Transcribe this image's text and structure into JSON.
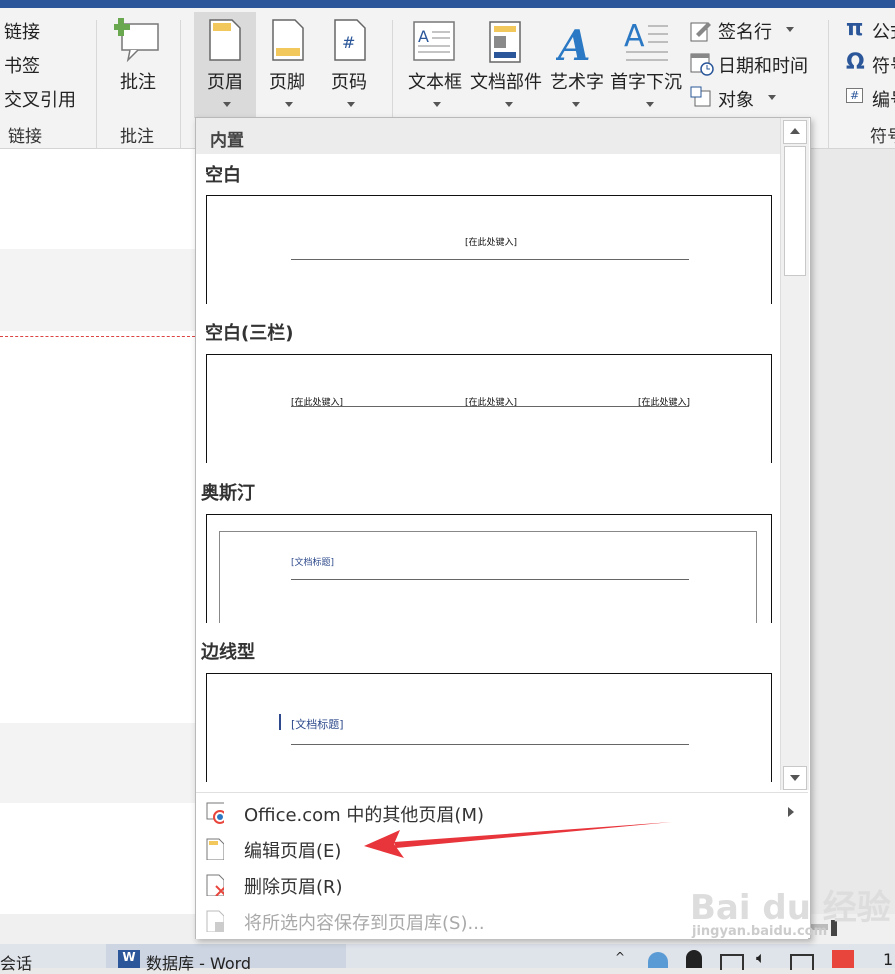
{
  "ribbon": {
    "links_group": {
      "items": [
        "链接",
        "书签",
        "交叉引用"
      ],
      "label": "链接"
    },
    "comments_group": {
      "button": "批注",
      "label": "批注"
    },
    "header_footer_group": {
      "header": "页眉",
      "footer": "页脚",
      "page_number": "页码"
    },
    "text_group": {
      "textbox": "文本框",
      "quickparts": "文档部件",
      "wordart": "艺术字",
      "dropcap": "首字下沉",
      "signature": "签名行",
      "datetime": "日期和时间",
      "object": "对象"
    },
    "symbols_group": {
      "equation": "公式",
      "symbol": "符号",
      "number": "编号",
      "label": "符号"
    }
  },
  "gallery": {
    "header": "内置",
    "sections": [
      {
        "title": "空白",
        "placeholders": [
          "[在此处键入]"
        ]
      },
      {
        "title": "空白(三栏)",
        "placeholders": [
          "[在此处键入]",
          "[在此处键入]",
          "[在此处键入]"
        ]
      },
      {
        "title": "奥斯汀",
        "placeholders": [
          "[文档标题]"
        ]
      },
      {
        "title": "边线型",
        "placeholders": [
          "[文档标题]"
        ]
      }
    ],
    "menu": [
      {
        "label": "Office.com 中的其他页眉(M)",
        "enabled": true
      },
      {
        "label": "编辑页眉(E)",
        "enabled": true
      },
      {
        "label": "删除页眉(R)",
        "enabled": true
      },
      {
        "label": "将所选内容保存到页眉库(S)...",
        "enabled": false
      }
    ]
  },
  "taskbar": {
    "left_text": "会话",
    "app_label": "数据库 - Word"
  },
  "colors": {
    "accent": "#2b579a",
    "annotation_arrow": "#e8353b"
  },
  "watermark": {
    "brand": "Bai du 经验",
    "url": "jingyan.baidu.com"
  }
}
